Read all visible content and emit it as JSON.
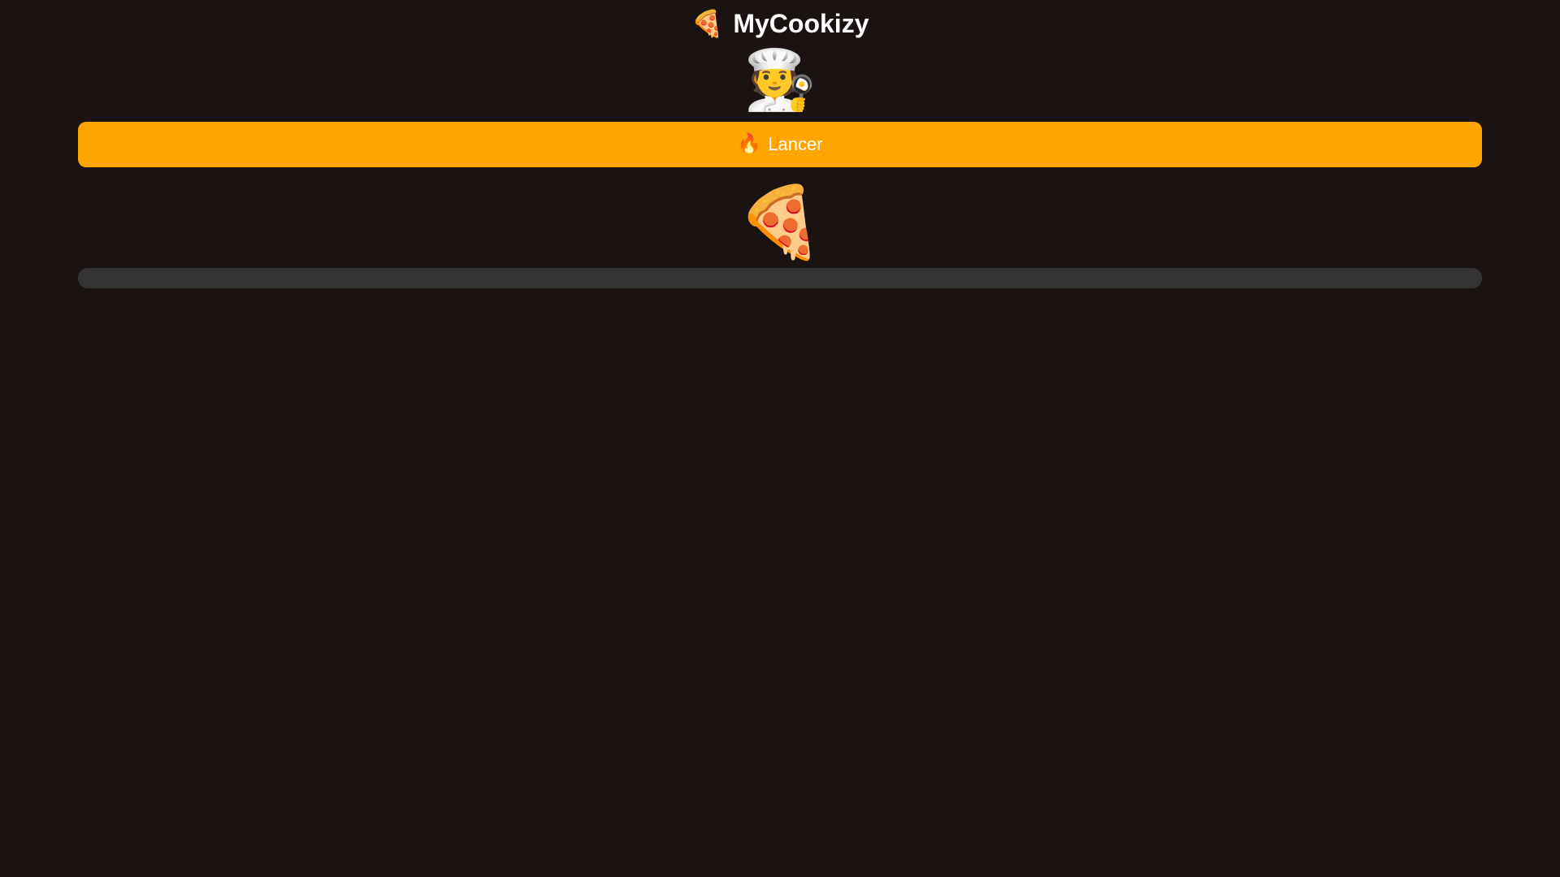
{
  "header": {
    "icon": "🍕",
    "icon_name": "pizza-icon",
    "title": "MyCookizy"
  },
  "chef": {
    "icon": "🧑‍🍳",
    "icon_name": "chef-icon"
  },
  "launch_button": {
    "icon": "🔥",
    "icon_name": "fire-icon",
    "label": "Lancer"
  },
  "pizza": {
    "icon": "🍕",
    "icon_name": "pizza-icon"
  },
  "progress": {
    "value": 0
  },
  "colors": {
    "background": "#1a1311",
    "accent": "#ffa500",
    "track": "#333333",
    "text": "#ffffff"
  }
}
